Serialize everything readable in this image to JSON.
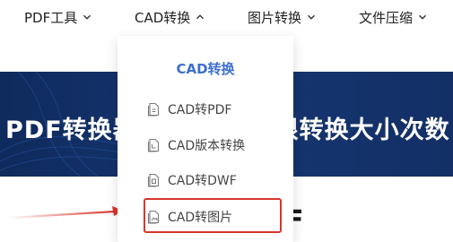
{
  "nav": {
    "items": [
      {
        "label": "PDF工具",
        "icon": "chevron-down-icon"
      },
      {
        "label": "CAD转换",
        "icon": "chevron-up-icon"
      },
      {
        "label": "图片转换",
        "icon": "chevron-down-icon"
      },
      {
        "label": "文件压缩",
        "icon": "chevron-down-icon"
      }
    ]
  },
  "hero": {
    "title_visible": "PDF转换器",
    "title_right_visible": "限转换大小次数"
  },
  "dropdown": {
    "title": "CAD转换",
    "items": [
      {
        "label": "CAD转PDF",
        "icon": "document-icon"
      },
      {
        "label": "CAD版本转换",
        "icon": "document-icon"
      },
      {
        "label": "CAD转DWF",
        "icon": "document-icon"
      },
      {
        "label": "CAD转图片",
        "icon": "image-file-icon",
        "highlighted": true
      }
    ]
  },
  "page": {
    "heading_fragment": "F"
  },
  "colors": {
    "accent": "#3d6fcf",
    "hero_bg": "#132f66",
    "annotation_red": "#d8352c"
  }
}
